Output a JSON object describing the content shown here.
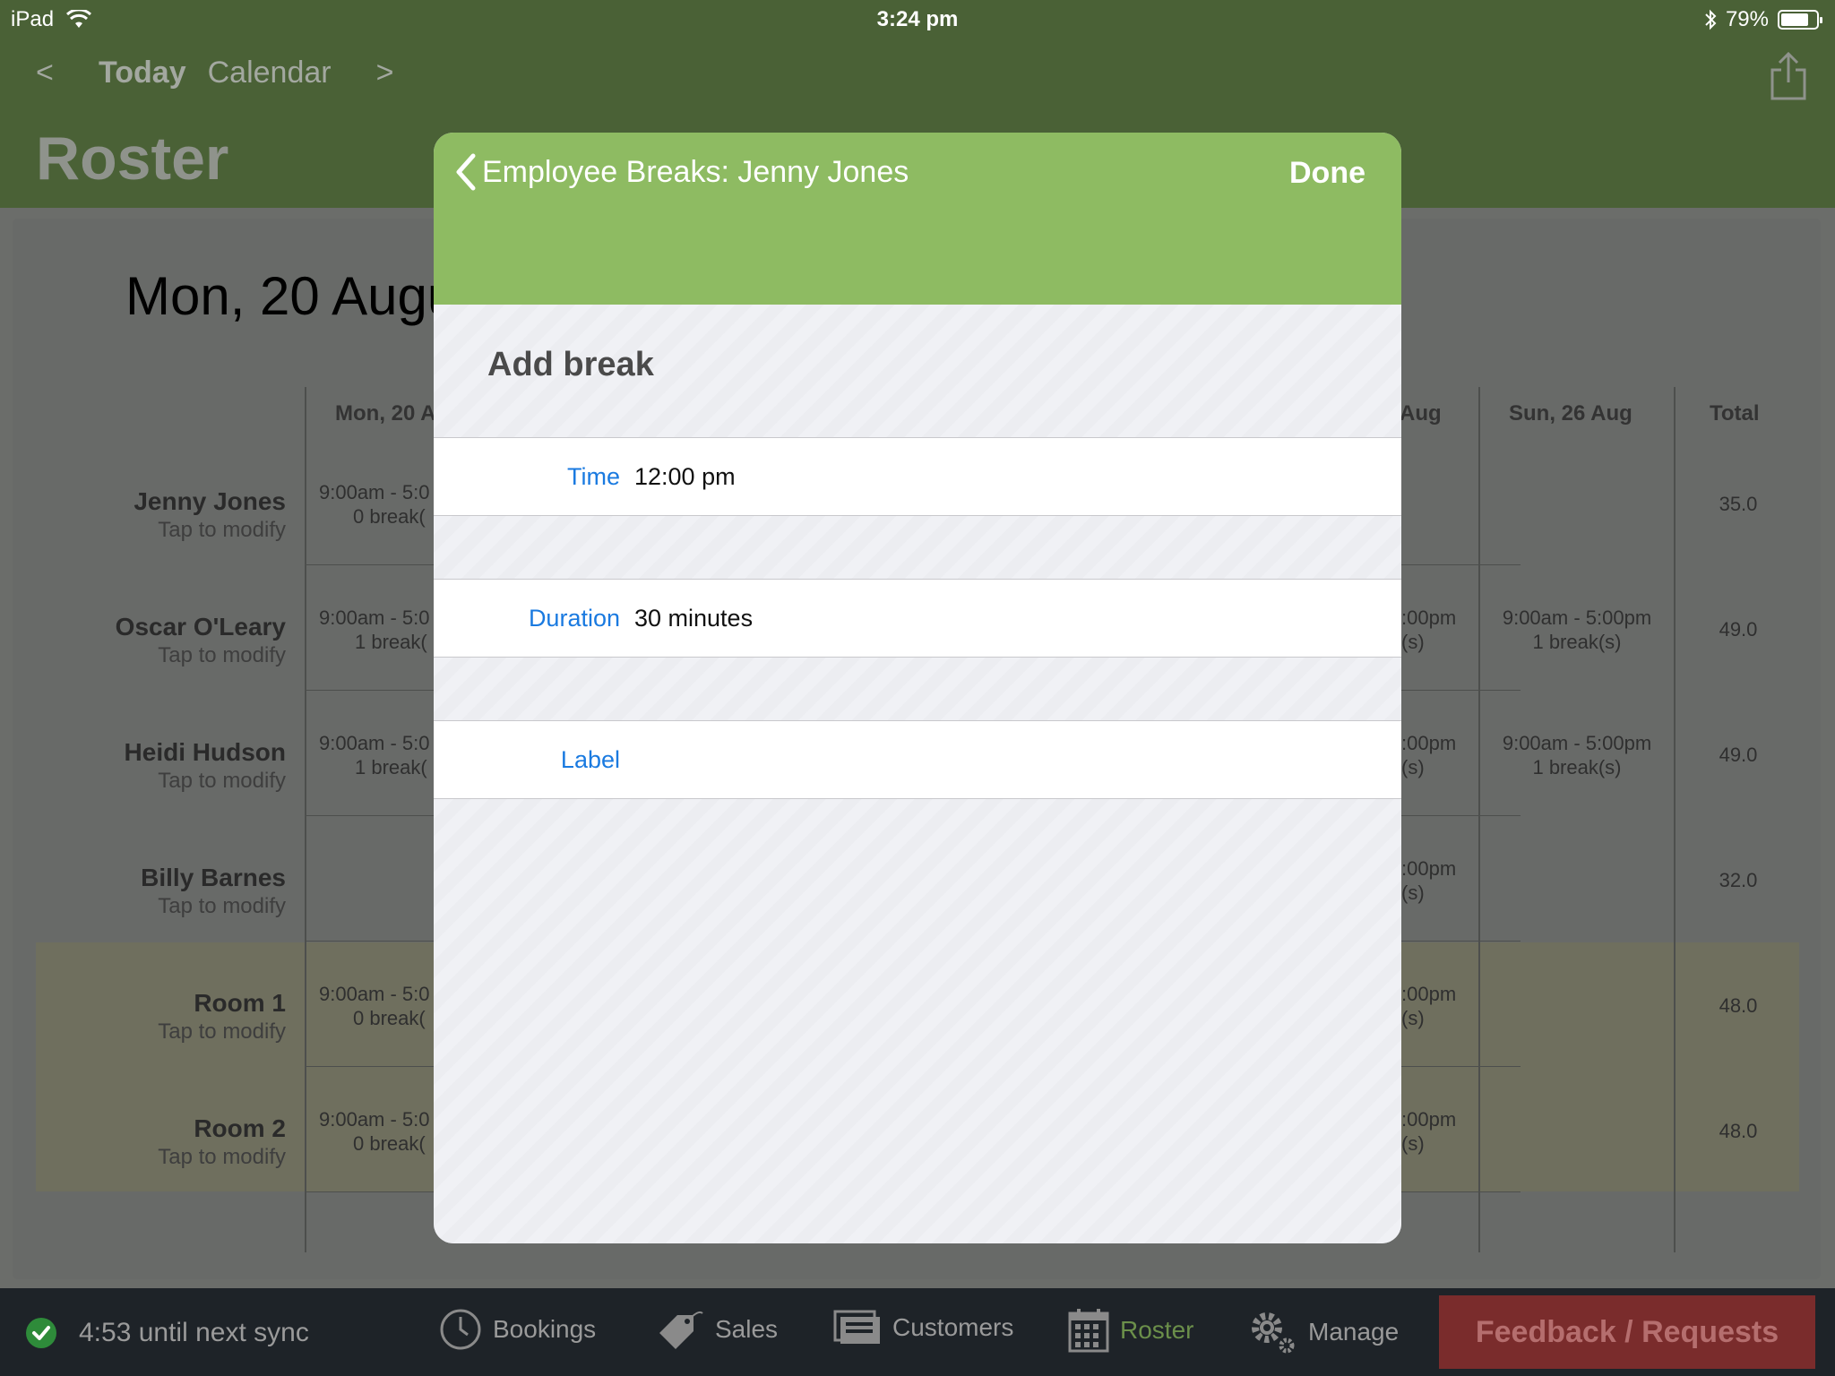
{
  "status_bar": {
    "device": "iPad",
    "time": "3:24 pm",
    "battery": "79%",
    "battery_level": 0.79
  },
  "nav": {
    "prev": "<",
    "today": "Today",
    "calendar": "Calendar",
    "next": ">",
    "title": "Roster"
  },
  "roster": {
    "date_heading": "Mon, 20 Augu",
    "columns": [
      "Mon, 20 A",
      "Aug",
      "Sun, 26 Aug",
      "Total"
    ],
    "tap_hint": "Tap to modify",
    "rows": [
      {
        "name": "Jenny Jones",
        "mon_time": "9:00am - 5:0",
        "mon_breaks": "0 break(",
        "sat_time": "",
        "sat_breaks": "",
        "sun_time": "",
        "sun_breaks": "",
        "total": "35.0"
      },
      {
        "name": "Oscar O'Leary",
        "mon_time": "9:00am - 5:0",
        "mon_breaks": "1 break(",
        "sat_time": ":00pm",
        "sat_breaks": "(s)",
        "sun_time": "9:00am - 5:00pm",
        "sun_breaks": "1 break(s)",
        "total": "49.0"
      },
      {
        "name": "Heidi Hudson",
        "mon_time": "9:00am - 5:0",
        "mon_breaks": "1 break(",
        "sat_time": ":00pm",
        "sat_breaks": "(s)",
        "sun_time": "9:00am - 5:00pm",
        "sun_breaks": "1 break(s)",
        "total": "49.0"
      },
      {
        "name": "Billy Barnes",
        "mon_time": "",
        "mon_breaks": "",
        "sat_time": ":00pm",
        "sat_breaks": "(s)",
        "sun_time": "",
        "sun_breaks": "",
        "total": "32.0"
      },
      {
        "name": "Room 1",
        "mon_time": "9:00am - 5:0",
        "mon_breaks": "0 break(",
        "sat_time": ":00pm",
        "sat_breaks": "(s)",
        "sun_time": "",
        "sun_breaks": "",
        "total": "48.0"
      },
      {
        "name": "Room 2",
        "mon_time": "9:00am - 5:0",
        "mon_breaks": "0 break(",
        "sat_time": ":00pm",
        "sat_breaks": "(s)",
        "sun_time": "",
        "sun_breaks": "",
        "total": "48.0"
      }
    ]
  },
  "modal": {
    "title": "Employee Breaks: Jenny Jones",
    "done": "Done",
    "section": "Add break",
    "fields": [
      {
        "label": "Time",
        "value": "12:00 pm"
      },
      {
        "label": "Duration",
        "value": "30 minutes"
      },
      {
        "label": "Label",
        "value": ""
      }
    ]
  },
  "tab_bar": {
    "sync": "4:53 until next sync",
    "tabs": [
      {
        "label": "Bookings",
        "icon": "clock-icon"
      },
      {
        "label": "Sales",
        "icon": "tag-icon"
      },
      {
        "label": "Customers",
        "icon": "customers-icon"
      },
      {
        "label": "Roster",
        "icon": "calendar-icon"
      },
      {
        "label": "Manage",
        "icon": "gear-icon"
      }
    ],
    "feedback": "Feedback / Requests"
  },
  "colors": {
    "header_green": "#4a6136",
    "modal_green": "#8ebb62",
    "link_blue": "#1a7ae0",
    "tab_active": "#6b8f4a",
    "feedback_red": "#7a2c2c"
  }
}
